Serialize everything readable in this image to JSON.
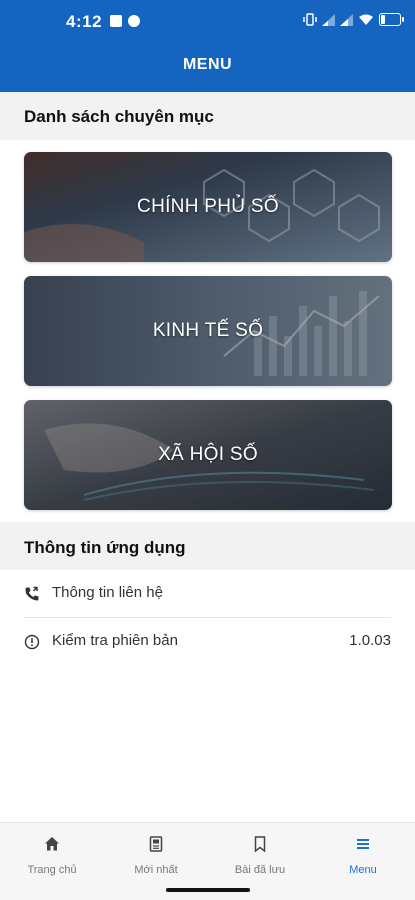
{
  "status_bar": {
    "time": "4:12",
    "battery": "12"
  },
  "app_bar": {
    "title": "MENU"
  },
  "categories_section": {
    "title": "Danh sách chuyên mục",
    "items": [
      {
        "label": "CHÍNH PHỦ SỐ"
      },
      {
        "label": "KINH TẾ SỐ"
      },
      {
        "label": "XÃ HỘI SỐ"
      }
    ]
  },
  "app_info_section": {
    "title": "Thông tin ứng dụng",
    "contact": {
      "label": "Thông tin liên hệ"
    },
    "version": {
      "label": "Kiểm tra phiên bản",
      "value": "1.0.03"
    }
  },
  "bottom_nav": {
    "items": [
      {
        "label": "Trang chủ",
        "icon": "home-icon"
      },
      {
        "label": "Mới nhất",
        "icon": "news-icon"
      },
      {
        "label": "Bài đã lưu",
        "icon": "bookmark-icon"
      },
      {
        "label": "Menu",
        "icon": "menu-icon"
      }
    ],
    "active_color": "#1e6fd6"
  },
  "colors": {
    "primary": "#1565c0"
  }
}
